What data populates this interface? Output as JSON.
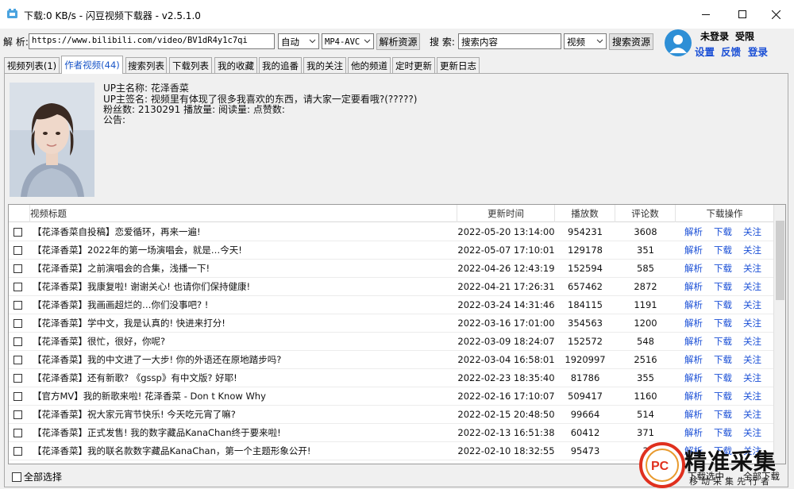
{
  "window": {
    "title": "下载:0 KB/s - 闪豆视频下载器 - v2.5.1.0"
  },
  "toolbar": {
    "parse_label": "解 析:",
    "url_value": "https://www.bilibili.com/video/BV1dR4y1c7qi",
    "mode_value": "自动",
    "format_value": "MP4-AVC",
    "parse_button": "解析资源",
    "search_label": "搜 索:",
    "search_placeholder": "搜索内容",
    "search_type_value": "视频",
    "search_button": "搜索资源"
  },
  "user": {
    "status": "未登录",
    "limit": "受限",
    "settings": "设置",
    "feedback": "反馈",
    "login": "登录"
  },
  "tabs": [
    {
      "label": "视频列表(1)"
    },
    {
      "label": "作者视频(44)"
    },
    {
      "label": "搜索列表"
    },
    {
      "label": "下载列表"
    },
    {
      "label": "我的收藏"
    },
    {
      "label": "我的追番"
    },
    {
      "label": "我的关注"
    },
    {
      "label": "他的频道"
    },
    {
      "label": "定时更新"
    },
    {
      "label": "更新日志"
    }
  ],
  "profile": {
    "name_line": "UP主名称: 花泽香菜",
    "sign_line": "UP主签名: 视频里有体现了很多我喜欢的东西，请大家一定要看哦?(?????)",
    "stats_line": "粉丝数: 2130291   播放量:    阅读量:    点赞数:",
    "notice_line": "公告:"
  },
  "table": {
    "headers": {
      "title": "视频标题",
      "time": "更新时间",
      "plays": "播放数",
      "comments": "评论数",
      "actions": "下载操作"
    },
    "action_labels": {
      "parse": "解析",
      "download": "下载",
      "follow": "关注"
    },
    "rows": [
      {
        "title": "【花泽香菜自投稿】恋爱循环，再来一遍!",
        "time": "2022-05-20 13:14:00",
        "plays": "954231",
        "comments": "3608"
      },
      {
        "title": "【花泽香菜】2022年的第一场演唱会，就是…今天!",
        "time": "2022-05-07 17:10:01",
        "plays": "129178",
        "comments": "351"
      },
      {
        "title": "【花泽香菜】之前演唱会的合集，浅播一下!",
        "time": "2022-04-26 12:43:19",
        "plays": "152594",
        "comments": "585"
      },
      {
        "title": "【花泽香菜】我康复啦! 谢谢关心! 也请你们保持健康!",
        "time": "2022-04-21 17:26:31",
        "plays": "657462",
        "comments": "2872"
      },
      {
        "title": "【花泽香菜】我画画超烂的…你们没事吧? !",
        "time": "2022-03-24 14:31:46",
        "plays": "184115",
        "comments": "1191"
      },
      {
        "title": "【花泽香菜】学中文，我是认真的! 快进来打分!",
        "time": "2022-03-16 17:01:00",
        "plays": "354563",
        "comments": "1200"
      },
      {
        "title": "【花泽香菜】很忙，很好，你呢?",
        "time": "2022-03-09 18:24:07",
        "plays": "152572",
        "comments": "548"
      },
      {
        "title": "【花泽香菜】我的中文进了一大步! 你的外语还在原地踏步吗?",
        "time": "2022-03-04 16:58:01",
        "plays": "1920997",
        "comments": "2516"
      },
      {
        "title": "【花泽香菜】还有新歌? 《gssp》有中文版? 好耶!",
        "time": "2022-02-23 18:35:40",
        "plays": "81786",
        "comments": "355"
      },
      {
        "title": "【官方MV】我的新歌来啦! 花泽香菜 - Don t Know Why",
        "time": "2022-02-16 17:10:07",
        "plays": "509417",
        "comments": "1160"
      },
      {
        "title": "【花泽香菜】祝大家元宵节快乐! 今天吃元宵了嘛?",
        "time": "2022-02-15 20:48:50",
        "plays": "99664",
        "comments": "514"
      },
      {
        "title": "【花泽香菜】正式发售! 我的数字藏品KanaChan终于要来啦!",
        "time": "2022-02-13 16:51:38",
        "plays": "60412",
        "comments": "371"
      },
      {
        "title": "【花泽香菜】我的联名款数字藏品KanaChan，第一个主题形象公开!",
        "time": "2022-02-10 18:32:55",
        "plays": "95473",
        "comments": "3"
      }
    ]
  },
  "footer": {
    "select_all": "全部选择",
    "download_selected": "下载选中",
    "download_all": "全部下载"
  },
  "watermark": {
    "logo": "PC",
    "text": "精准采集",
    "sub": "移动采集先行者"
  }
}
